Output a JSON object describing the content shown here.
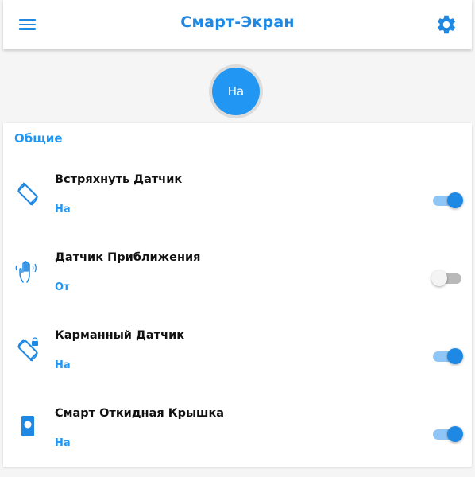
{
  "appbar": {
    "title": "Смарт-Экран",
    "menu_icon": "menu-icon",
    "settings_icon": "gear-icon"
  },
  "master_toggle": {
    "label": "На",
    "state": "on"
  },
  "section": {
    "title": "Общие",
    "items": [
      {
        "title": "Встряхнуть Датчик",
        "status": "На",
        "enabled": true,
        "icon": "screen-rotation-icon"
      },
      {
        "title": "Датчик Приближения",
        "status": "От",
        "enabled": false,
        "icon": "hand-wave-icon"
      },
      {
        "title": "Карманный Датчик",
        "status": "На",
        "enabled": true,
        "icon": "screen-lock-rotation-icon"
      },
      {
        "title": "Смарт Откидная Крышка",
        "status": "На",
        "enabled": true,
        "icon": "flip-cover-icon"
      }
    ]
  },
  "colors": {
    "accent": "#1e88e5",
    "accent_light": "#2196f3",
    "switch_track_on": "#90c6f6",
    "switch_track_off": "#b9b9b9"
  }
}
